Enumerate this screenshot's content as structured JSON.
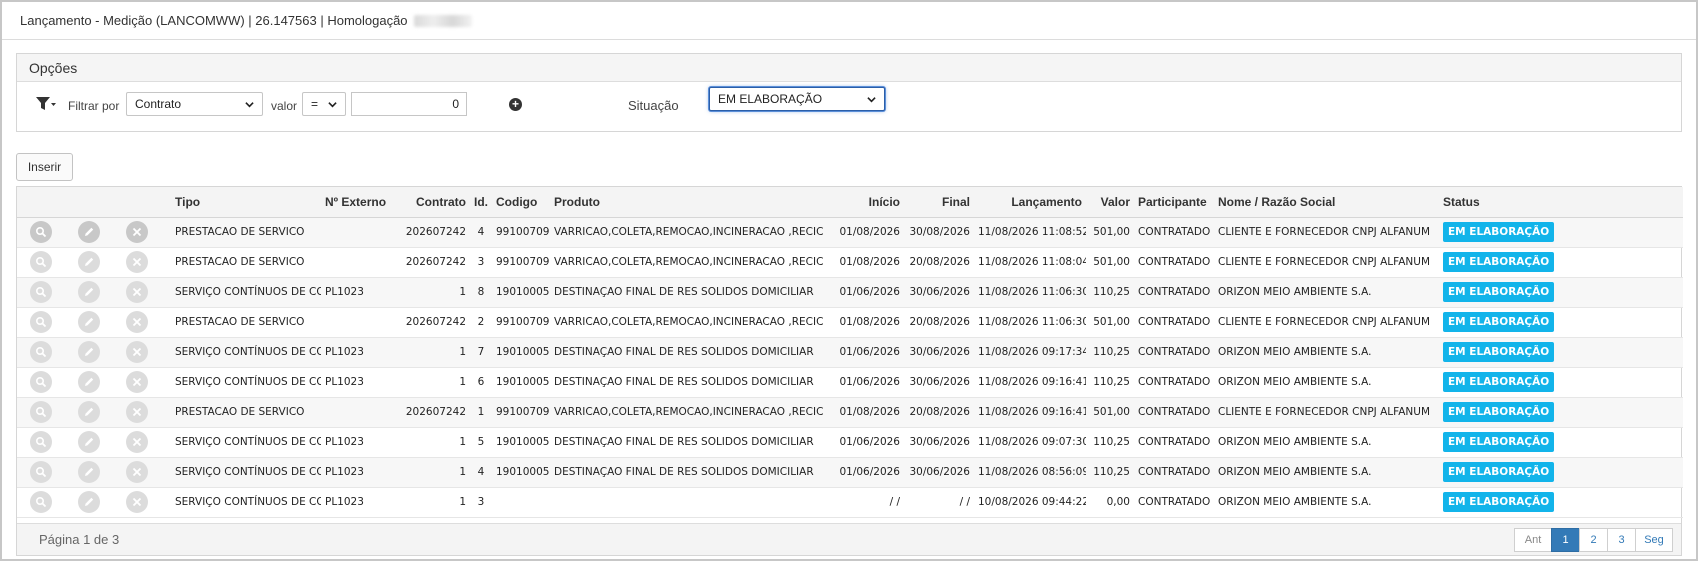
{
  "window": {
    "title": "Lançamento - Medição (LANCOMWW) | 26.147563 | Homologação"
  },
  "options": {
    "heading": "Opções",
    "filter_by_label": "Filtrar por",
    "filter_field": "Contrato",
    "value_label": "valor",
    "operator": "=",
    "filter_value": "0",
    "situacao_label": "Situação",
    "situacao_value": "EM ELABORAÇÃO"
  },
  "toolbar": {
    "insert_label": "Inserir"
  },
  "table": {
    "headers": {
      "tipo": "Tipo",
      "externo": "Nº Externo",
      "contrato": "Contrato",
      "id": "Id.",
      "codigo": "Codigo",
      "produto": "Produto",
      "inicio": "Início",
      "final": "Final",
      "lancamento": "Lançamento",
      "valor": "Valor",
      "participante": "Participante",
      "nome": "Nome / Razão Social",
      "status": "Status"
    },
    "rows": [
      {
        "tipo": "PRESTACAO DE SERVICO",
        "externo": "",
        "contrato": "202607242",
        "id": "4",
        "codigo": "99100709",
        "produto": "VARRICAO,COLETA,REMOCAO,INCINERACAO ,RECICLAGEM",
        "inicio": "01/08/2026",
        "final": "30/08/2026",
        "lancamento": "11/08/2026 11:08:52",
        "valor": "501,00",
        "participante": "CONTRATADO",
        "nome": "CLIENTE E FORNECEDOR CNPJ ALFANUMERICO",
        "status": "EM ELABORAÇÃO"
      },
      {
        "tipo": "PRESTACAO DE SERVICO",
        "externo": "",
        "contrato": "202607242",
        "id": "3",
        "codigo": "99100709",
        "produto": "VARRICAO,COLETA,REMOCAO,INCINERACAO ,RECICLAGEM",
        "inicio": "01/08/2026",
        "final": "20/08/2026",
        "lancamento": "11/08/2026 11:08:04",
        "valor": "501,00",
        "participante": "CONTRATADO",
        "nome": "CLIENTE E FORNECEDOR CNPJ ALFANUMERICO",
        "status": "EM ELABORAÇÃO"
      },
      {
        "tipo": "SERVIÇO CONTÍNUOS DE COLETA",
        "externo": "PL1023",
        "contrato": "1",
        "id": "8",
        "codigo": "19010005",
        "produto": "DESTINAÇAO FINAL DE RES SOLIDOS DOMICILIAR",
        "inicio": "01/06/2026",
        "final": "30/06/2026",
        "lancamento": "11/08/2026 11:06:30",
        "valor": "110,25",
        "participante": "CONTRATADO",
        "nome": "ORIZON MEIO AMBIENTE S.A.",
        "status": "EM ELABORAÇÃO"
      },
      {
        "tipo": "PRESTACAO DE SERVICO",
        "externo": "",
        "contrato": "202607242",
        "id": "2",
        "codigo": "99100709",
        "produto": "VARRICAO,COLETA,REMOCAO,INCINERACAO ,RECICLAGEM",
        "inicio": "01/08/2026",
        "final": "20/08/2026",
        "lancamento": "11/08/2026 11:06:30",
        "valor": "501,00",
        "participante": "CONTRATADO",
        "nome": "CLIENTE E FORNECEDOR CNPJ ALFANUMERICO",
        "status": "EM ELABORAÇÃO"
      },
      {
        "tipo": "SERVIÇO CONTÍNUOS DE COLETA",
        "externo": "PL1023",
        "contrato": "1",
        "id": "7",
        "codigo": "19010005",
        "produto": "DESTINAÇAO FINAL DE RES SOLIDOS DOMICILIAR",
        "inicio": "01/06/2026",
        "final": "30/06/2026",
        "lancamento": "11/08/2026 09:17:34",
        "valor": "110,25",
        "participante": "CONTRATADO",
        "nome": "ORIZON MEIO AMBIENTE S.A.",
        "status": "EM ELABORAÇÃO"
      },
      {
        "tipo": "SERVIÇO CONTÍNUOS DE COLETA",
        "externo": "PL1023",
        "contrato": "1",
        "id": "6",
        "codigo": "19010005",
        "produto": "DESTINAÇAO FINAL DE RES SOLIDOS DOMICILIAR",
        "inicio": "01/06/2026",
        "final": "30/06/2026",
        "lancamento": "11/08/2026 09:16:41",
        "valor": "110,25",
        "participante": "CONTRATADO",
        "nome": "ORIZON MEIO AMBIENTE S.A.",
        "status": "EM ELABORAÇÃO"
      },
      {
        "tipo": "PRESTACAO DE SERVICO",
        "externo": "",
        "contrato": "202607242",
        "id": "1",
        "codigo": "99100709",
        "produto": "VARRICAO,COLETA,REMOCAO,INCINERACAO ,RECICLAGEM",
        "inicio": "01/08/2026",
        "final": "20/08/2026",
        "lancamento": "11/08/2026 09:16:41",
        "valor": "501,00",
        "participante": "CONTRATADO",
        "nome": "CLIENTE E FORNECEDOR CNPJ ALFANUMERICO",
        "status": "EM ELABORAÇÃO"
      },
      {
        "tipo": "SERVIÇO CONTÍNUOS DE COLETA",
        "externo": "PL1023",
        "contrato": "1",
        "id": "5",
        "codigo": "19010005",
        "produto": "DESTINAÇAO FINAL DE RES SOLIDOS DOMICILIAR",
        "inicio": "01/06/2026",
        "final": "30/06/2026",
        "lancamento": "11/08/2026 09:07:30",
        "valor": "110,25",
        "participante": "CONTRATADO",
        "nome": "ORIZON MEIO AMBIENTE S.A.",
        "status": "EM ELABORAÇÃO"
      },
      {
        "tipo": "SERVIÇO CONTÍNUOS DE COLETA",
        "externo": "PL1023",
        "contrato": "1",
        "id": "4",
        "codigo": "19010005",
        "produto": "DESTINAÇAO FINAL DE RES SOLIDOS DOMICILIAR",
        "inicio": "01/06/2026",
        "final": "30/06/2026",
        "lancamento": "11/08/2026 08:56:09",
        "valor": "110,25",
        "participante": "CONTRATADO",
        "nome": "ORIZON MEIO AMBIENTE S.A.",
        "status": "EM ELABORAÇÃO"
      },
      {
        "tipo": "SERVIÇO CONTÍNUOS DE COLETA",
        "externo": "PL1023",
        "contrato": "1",
        "id": "3",
        "codigo": "",
        "produto": "",
        "inicio": "/ /",
        "final": "/ /",
        "lancamento": "10/08/2026 09:44:22",
        "valor": "0,00",
        "participante": "CONTRATADO",
        "nome": "ORIZON MEIO AMBIENTE S.A.",
        "status": "EM ELABORAÇÃO"
      }
    ]
  },
  "pagination": {
    "info": "Página 1 de 3",
    "prev": "Ant",
    "pages": [
      "1",
      "2",
      "3"
    ],
    "next": "Seg",
    "active_page": "1"
  },
  "colors": {
    "status_badge": "#12b4ea",
    "page_active": "#337ab7"
  },
  "icons": {
    "row_actions": [
      "search-icon",
      "pencil-icon",
      "close-icon"
    ],
    "filter": "funnel-icon",
    "add": "plus-circle-icon"
  }
}
